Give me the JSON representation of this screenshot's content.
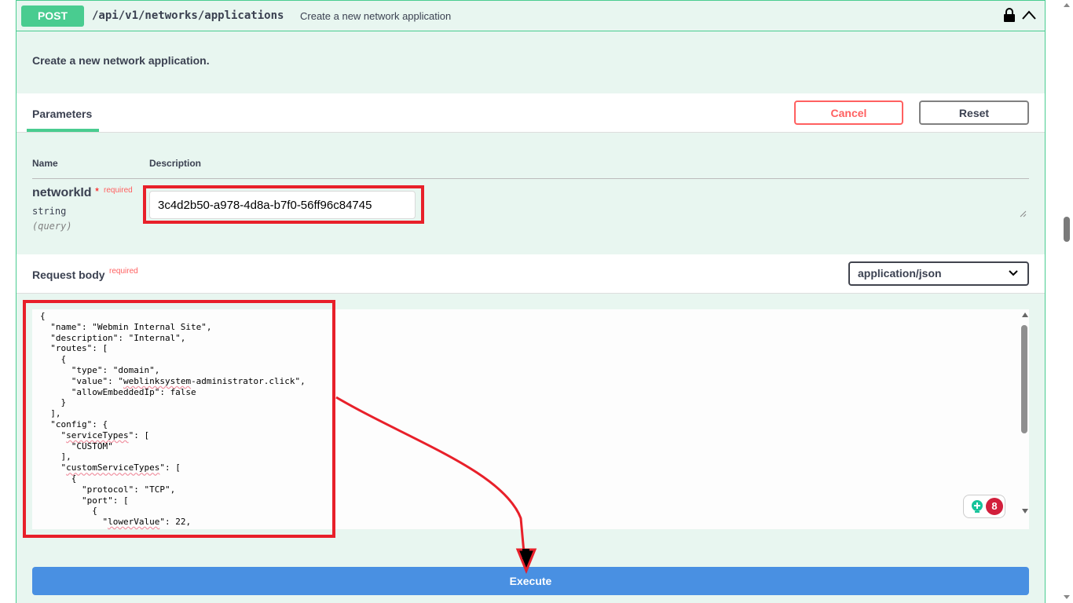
{
  "operation": {
    "method": "POST",
    "path": "/api/v1/networks/applications",
    "summary": "Create a new network application",
    "description": "Create a new network application.",
    "accent_color": "#49cc90"
  },
  "parameters": {
    "tab_label": "Parameters",
    "cancel_label": "Cancel",
    "reset_label": "Reset",
    "col_name": "Name",
    "col_description": "Description",
    "items": [
      {
        "name": "networkId",
        "required_star": "*",
        "required_label": "required",
        "type": "string",
        "in": "(query)",
        "value": "3c4d2b50-a978-4d8a-b7f0-56ff96c84745"
      }
    ]
  },
  "request_body": {
    "title": "Request body",
    "required_label": "required",
    "content_type": "application/json",
    "code_lines": [
      "{",
      "  \"name\": \"Webmin Internal Site\",",
      "  \"description\": \"Internal\",",
      "  \"routes\": [",
      "    {",
      "      \"type\": \"domain\",",
      "      \"value\": \"weblinksystem-administrator.click\",",
      "      \"allowEmbeddedIp\": false",
      "    }",
      "  ],",
      "  \"config\": {",
      "    \"serviceTypes\": [",
      "      \"CUSTOM\"",
      "    ],",
      "    \"customServiceTypes\": [",
      "      {",
      "        \"protocol\": \"TCP\",",
      "        \"port\": [",
      "          {",
      "            \"lowerValue\": 22,"
    ]
  },
  "grammar_badge": {
    "count": "8"
  },
  "execute_label": "Execute",
  "highlight_color": "#e8202a"
}
